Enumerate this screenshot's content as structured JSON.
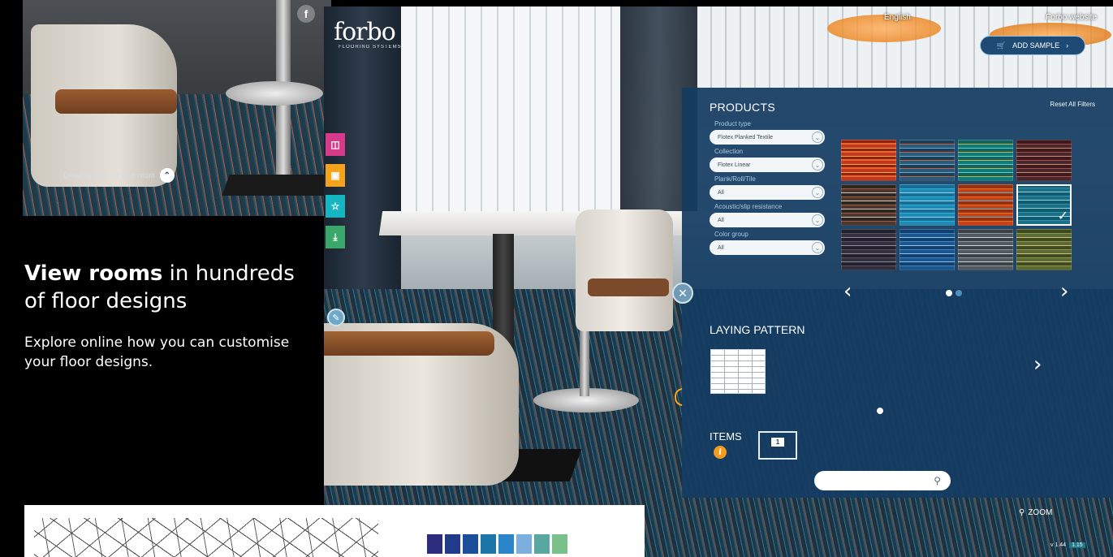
{
  "thumbnail": {
    "caption": "Detail options of your room",
    "social_icon": "f"
  },
  "promo": {
    "headline_bold": "View rooms",
    "headline_rest": " in hundreds of floor designs",
    "body": "Explore online how you can customise your floor designs."
  },
  "app": {
    "brand": "forbo",
    "brand_sub": "FLOORING SYSTEMS",
    "top_links": [
      "English",
      "Forbo website"
    ],
    "add_sample_label": "ADD SAMPLE",
    "zoom_label": "ZOOM",
    "version_left": "v 1.44",
    "version_right": "1.15"
  },
  "panel": {
    "title": "PRODUCTS",
    "reset_label": "Reset All Filters",
    "filters": [
      {
        "label": "Product type",
        "value": "Flotex Planked Textile"
      },
      {
        "label": "Collection",
        "value": "Flotex Linear"
      },
      {
        "label": "Plank/Roll/Tile",
        "value": "All"
      },
      {
        "label": "Acoustic/slip resistance",
        "value": "All"
      },
      {
        "label": "Color group",
        "value": "All"
      }
    ],
    "swatches_selected_index": 7,
    "laying_pattern_title": "LAYING PATTERN",
    "items_label": "ITEMS",
    "items_count": "1"
  },
  "colors": {
    "panel_bg": "#143c62",
    "accent_orange": "#f39c1e",
    "tool_pink": "#d63a8b",
    "tool_orange": "#f3a31c",
    "tool_teal": "#15b5c2",
    "tool_green": "#3ba76b"
  },
  "bottom_strip": {
    "chips": [
      "#2c2e7d",
      "#1f3b8a",
      "#1b4f9a",
      "#1d76a8",
      "#2a86c8",
      "#7bb0de",
      "#5aa7a1",
      "#7ac08a"
    ]
  }
}
